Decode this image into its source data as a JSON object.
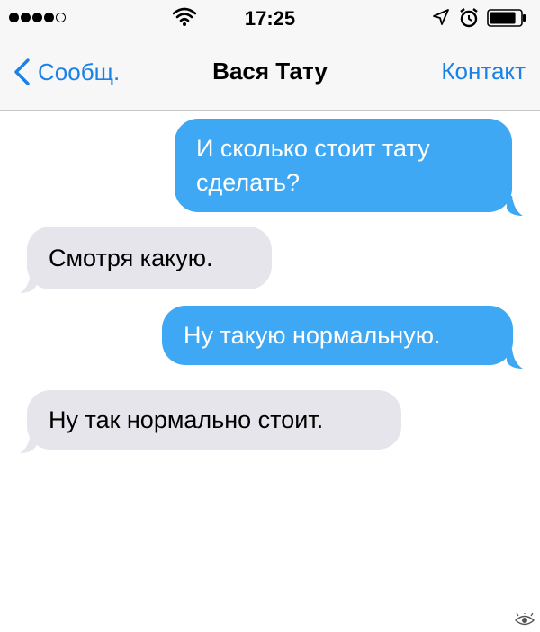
{
  "status_bar": {
    "signal_filled": 4,
    "signal_total": 5,
    "signal_icon": "signal-dots-icon",
    "wifi_icon": "wifi-icon",
    "time": "17:25",
    "location_icon": "location-arrow-icon",
    "alarm_icon": "alarm-clock-icon",
    "battery_icon": "battery-icon",
    "battery_level": 0.85
  },
  "nav": {
    "back_icon": "chevron-left-icon",
    "back_label": "Сообщ.",
    "title": "Вася Тату",
    "contact_label": "Контакт",
    "accent_color": "#1a82e6"
  },
  "messages": [
    {
      "direction": "outgoing",
      "text": "И сколько стоит тату сделать?"
    },
    {
      "direction": "incoming",
      "text": "Смотря какую."
    },
    {
      "direction": "outgoing",
      "text": "Ну такую нормальную."
    },
    {
      "direction": "incoming",
      "text": "Ну так нормально стоит."
    }
  ],
  "colors": {
    "outgoing_bubble": "#3ea8f5",
    "incoming_bubble": "#e6e5eb",
    "header_bg": "#f7f7f8"
  },
  "watermark_icon": "eye-watermark-icon"
}
